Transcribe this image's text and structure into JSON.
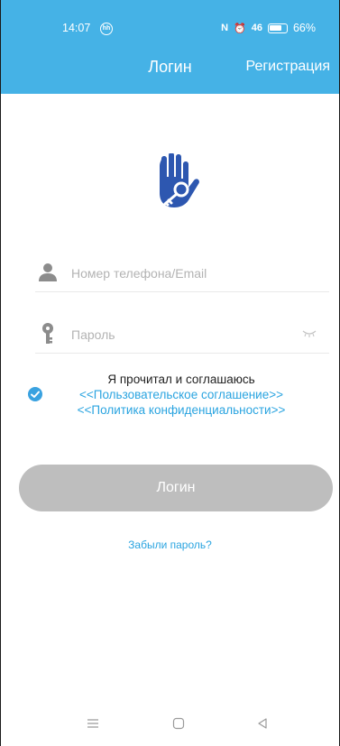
{
  "status_bar": {
    "time": "14:07",
    "indicator": "hh",
    "signal_text": "46",
    "battery": "66%"
  },
  "header": {
    "title": "Логин",
    "register_label": "Регистрация",
    "background": "#45b2e6"
  },
  "form": {
    "phone_placeholder": "Номер телефона/Email",
    "phone_value": "",
    "password_placeholder": "Пароль",
    "password_value": ""
  },
  "agreement": {
    "checked": true,
    "intro": "Я прочитал и соглашаюсь",
    "user_agreement": "<<Пользовательское соглашение>>",
    "privacy_policy": "<<Политика конфиденциальности>>"
  },
  "login_button_label": "Логин",
  "forgot_password_label": "Забыли пароль?",
  "accent_color": "#2aa4e0",
  "icons": [
    "hand-key-logo-icon",
    "user-icon",
    "key-icon",
    "eye-closed-icon",
    "check-icon",
    "menu-icon",
    "home-icon",
    "back-icon"
  ]
}
